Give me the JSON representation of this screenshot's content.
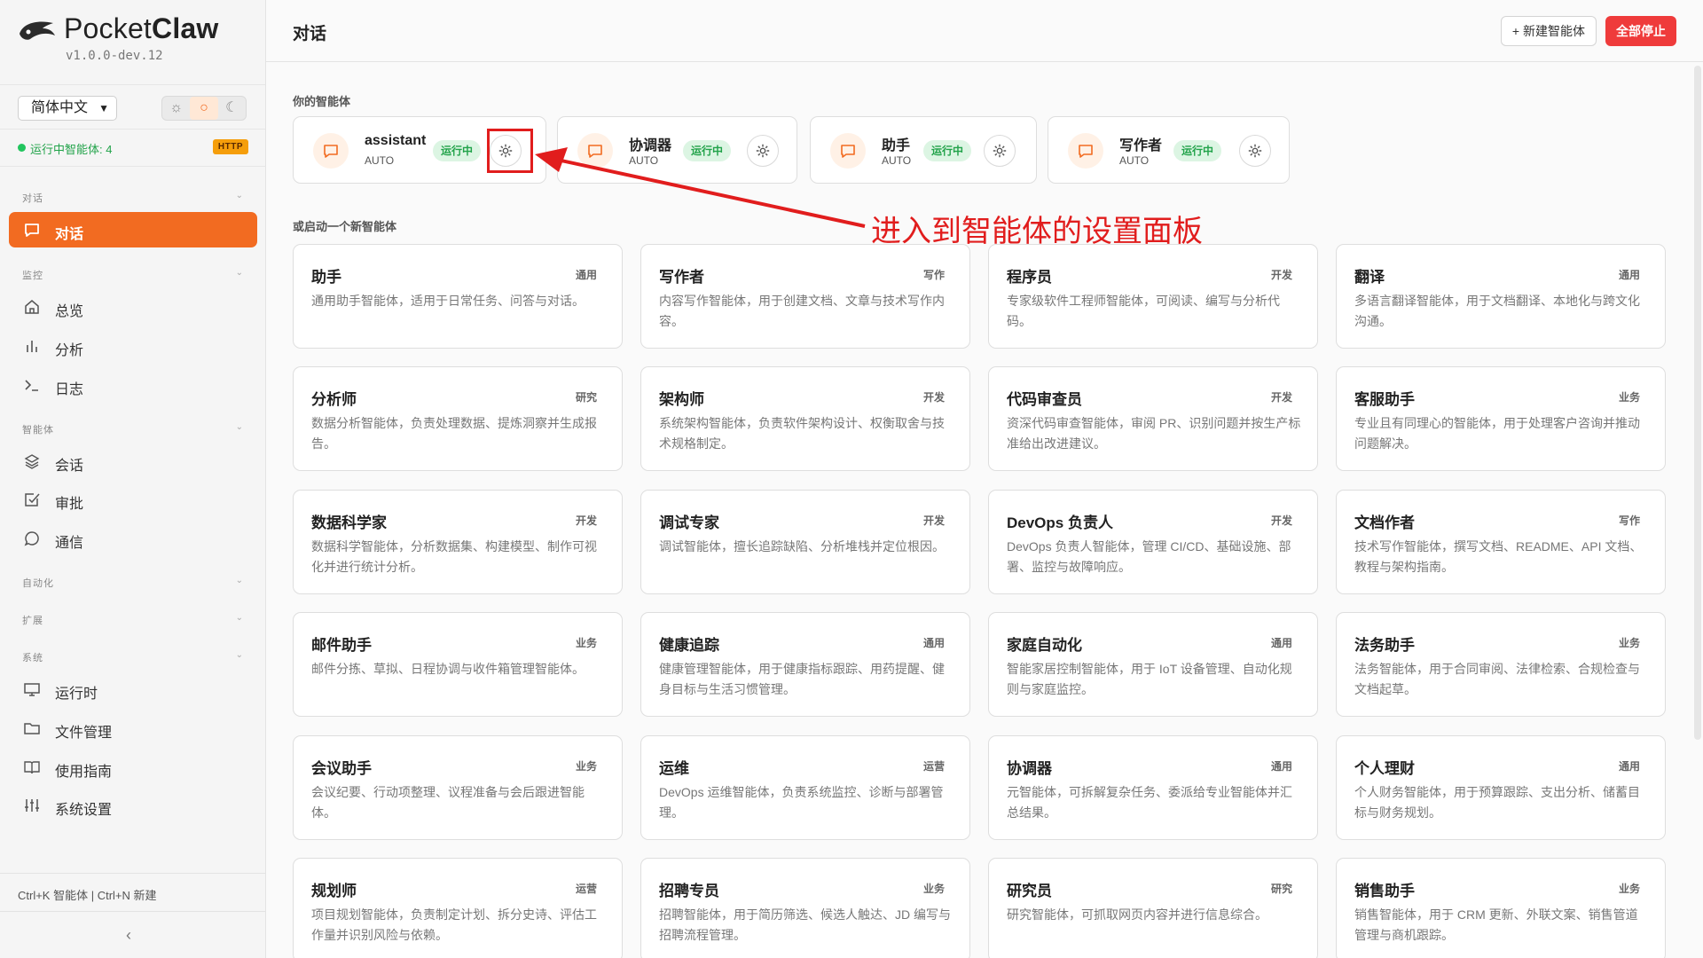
{
  "app": {
    "name_light": "Pocket",
    "name_bold": "Claw",
    "version": "v1.0.0-dev.12"
  },
  "language": {
    "selected": "简体中文"
  },
  "theme": {
    "options": [
      "☼",
      "○",
      "☾"
    ]
  },
  "status": {
    "running_text": "运行中智能体: 4",
    "badge": "HTTP"
  },
  "sidebar": {
    "sections": {
      "chat": "对话",
      "monitor": "监控",
      "agents": "智能体",
      "automation": "自动化",
      "extensions": "扩展",
      "system": "系统"
    },
    "items": {
      "chat": "对话",
      "overview": "总览",
      "analytics": "分析",
      "logs": "日志",
      "sessions": "会话",
      "approval": "审批",
      "comms": "通信",
      "runtime": "运行时",
      "files": "文件管理",
      "guide": "使用指南",
      "settings": "系统设置"
    },
    "shortcut": "Ctrl+K 智能体 | Ctrl+N 新建",
    "collapse": "‹"
  },
  "header": {
    "title": "对话",
    "new_agent": "+ 新建智能体",
    "stop_all": "全部停止"
  },
  "main": {
    "your_agents_label": "你的智能体",
    "new_agent_label": "或启动一个新智能体",
    "running_agents": [
      {
        "name": "assistant",
        "mode": "AUTO",
        "status": "运行中"
      },
      {
        "name": "协调器",
        "mode": "AUTO",
        "status": "运行中"
      },
      {
        "name": "助手",
        "mode": "AUTO",
        "status": "运行中"
      },
      {
        "name": "写作者",
        "mode": "AUTO",
        "status": "运行中"
      }
    ],
    "annotation": "进入到智能体的设置面板",
    "templates": [
      {
        "title": "助手",
        "tag": "通用",
        "desc": "通用助手智能体，适用于日常任务、问答与对话。"
      },
      {
        "title": "写作者",
        "tag": "写作",
        "desc": "内容写作智能体，用于创建文档、文章与技术写作内容。"
      },
      {
        "title": "程序员",
        "tag": "开发",
        "desc": "专家级软件工程师智能体，可阅读、编写与分析代码。"
      },
      {
        "title": "翻译",
        "tag": "通用",
        "desc": "多语言翻译智能体，用于文档翻译、本地化与跨文化沟通。"
      },
      {
        "title": "分析师",
        "tag": "研究",
        "desc": "数据分析智能体，负责处理数据、提炼洞察并生成报告。"
      },
      {
        "title": "架构师",
        "tag": "开发",
        "desc": "系统架构智能体，负责软件架构设计、权衡取舍与技术规格制定。"
      },
      {
        "title": "代码审查员",
        "tag": "开发",
        "desc": "资深代码审查智能体，审阅 PR、识别问题并按生产标准给出改进建议。"
      },
      {
        "title": "客服助手",
        "tag": "业务",
        "desc": "专业且有同理心的智能体，用于处理客户咨询并推动问题解决。"
      },
      {
        "title": "数据科学家",
        "tag": "开发",
        "desc": "数据科学智能体，分析数据集、构建模型、制作可视化并进行统计分析。"
      },
      {
        "title": "调试专家",
        "tag": "开发",
        "desc": "调试智能体，擅长追踪缺陷、分析堆栈并定位根因。"
      },
      {
        "title": "DevOps 负责人",
        "tag": "开发",
        "desc": "DevOps 负责人智能体，管理 CI/CD、基础设施、部署、监控与故障响应。"
      },
      {
        "title": "文档作者",
        "tag": "写作",
        "desc": "技术写作智能体，撰写文档、README、API 文档、教程与架构指南。"
      },
      {
        "title": "邮件助手",
        "tag": "业务",
        "desc": "邮件分拣、草拟、日程协调与收件箱管理智能体。"
      },
      {
        "title": "健康追踪",
        "tag": "通用",
        "desc": "健康管理智能体，用于健康指标跟踪、用药提醒、健身目标与生活习惯管理。"
      },
      {
        "title": "家庭自动化",
        "tag": "通用",
        "desc": "智能家居控制智能体，用于 IoT 设备管理、自动化规则与家庭监控。"
      },
      {
        "title": "法务助手",
        "tag": "业务",
        "desc": "法务智能体，用于合同审阅、法律检索、合规检查与文档起草。"
      },
      {
        "title": "会议助手",
        "tag": "业务",
        "desc": "会议纪要、行动项整理、议程准备与会后跟进智能体。"
      },
      {
        "title": "运维",
        "tag": "运营",
        "desc": "DevOps 运维智能体，负责系统监控、诊断与部署管理。"
      },
      {
        "title": "协调器",
        "tag": "通用",
        "desc": "元智能体，可拆解复杂任务、委派给专业智能体并汇总结果。"
      },
      {
        "title": "个人理财",
        "tag": "通用",
        "desc": "个人财务智能体，用于预算跟踪、支出分析、储蓄目标与财务规划。"
      },
      {
        "title": "规划师",
        "tag": "运营",
        "desc": "项目规划智能体，负责制定计划、拆分史诗、评估工作量并识别风险与依赖。"
      },
      {
        "title": "招聘专员",
        "tag": "业务",
        "desc": "招聘智能体，用于简历筛选、候选人触达、JD 编写与招聘流程管理。"
      },
      {
        "title": "研究员",
        "tag": "研究",
        "desc": "研究智能体，可抓取网页内容并进行信息综合。"
      },
      {
        "title": "销售助手",
        "tag": "业务",
        "desc": "销售智能体，用于 CRM 更新、外联文案、销售管道管理与商机跟踪。"
      }
    ]
  },
  "colors": {
    "accent": "#f26b21",
    "running": "#22a34a",
    "danger": "#ef3b3b",
    "annotation": "#e11d1d"
  }
}
